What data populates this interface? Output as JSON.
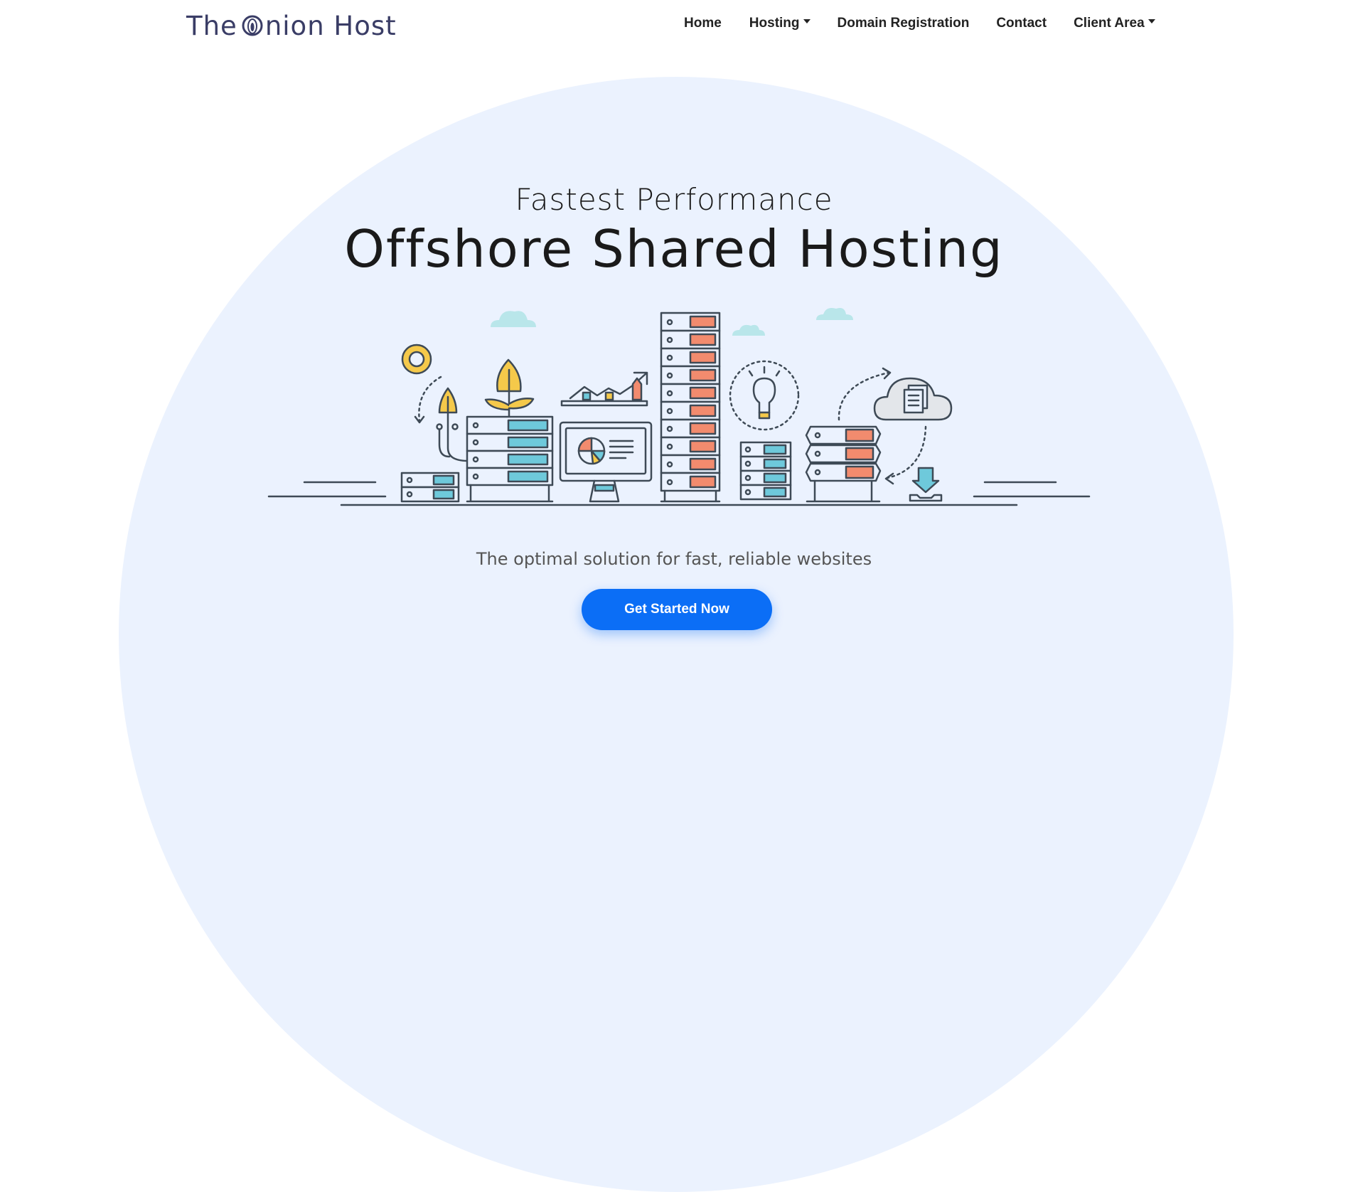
{
  "brand": {
    "name_left": "The ",
    "name_right": "nion Host"
  },
  "nav": {
    "items": [
      {
        "label": "Home",
        "dropdown": false
      },
      {
        "label": "Hosting",
        "dropdown": true
      },
      {
        "label": "Domain Registration",
        "dropdown": false
      },
      {
        "label": "Contact",
        "dropdown": false
      },
      {
        "label": "Client Area",
        "dropdown": true
      }
    ]
  },
  "hero": {
    "subtitle": "Fastest Performance",
    "title": "Offshore Shared Hosting",
    "tagline": "The optimal solution for fast, reliable websites",
    "cta": "Get Started Now"
  },
  "colors": {
    "accent": "#0b6ef6",
    "background_circle": "#ebf2fe",
    "brand_text": "#3a3d66",
    "illustration_orange": "#f28b6e",
    "illustration_teal": "#6ec9db",
    "illustration_yellow": "#f5c94a",
    "illustration_stroke": "#3e4a56"
  }
}
